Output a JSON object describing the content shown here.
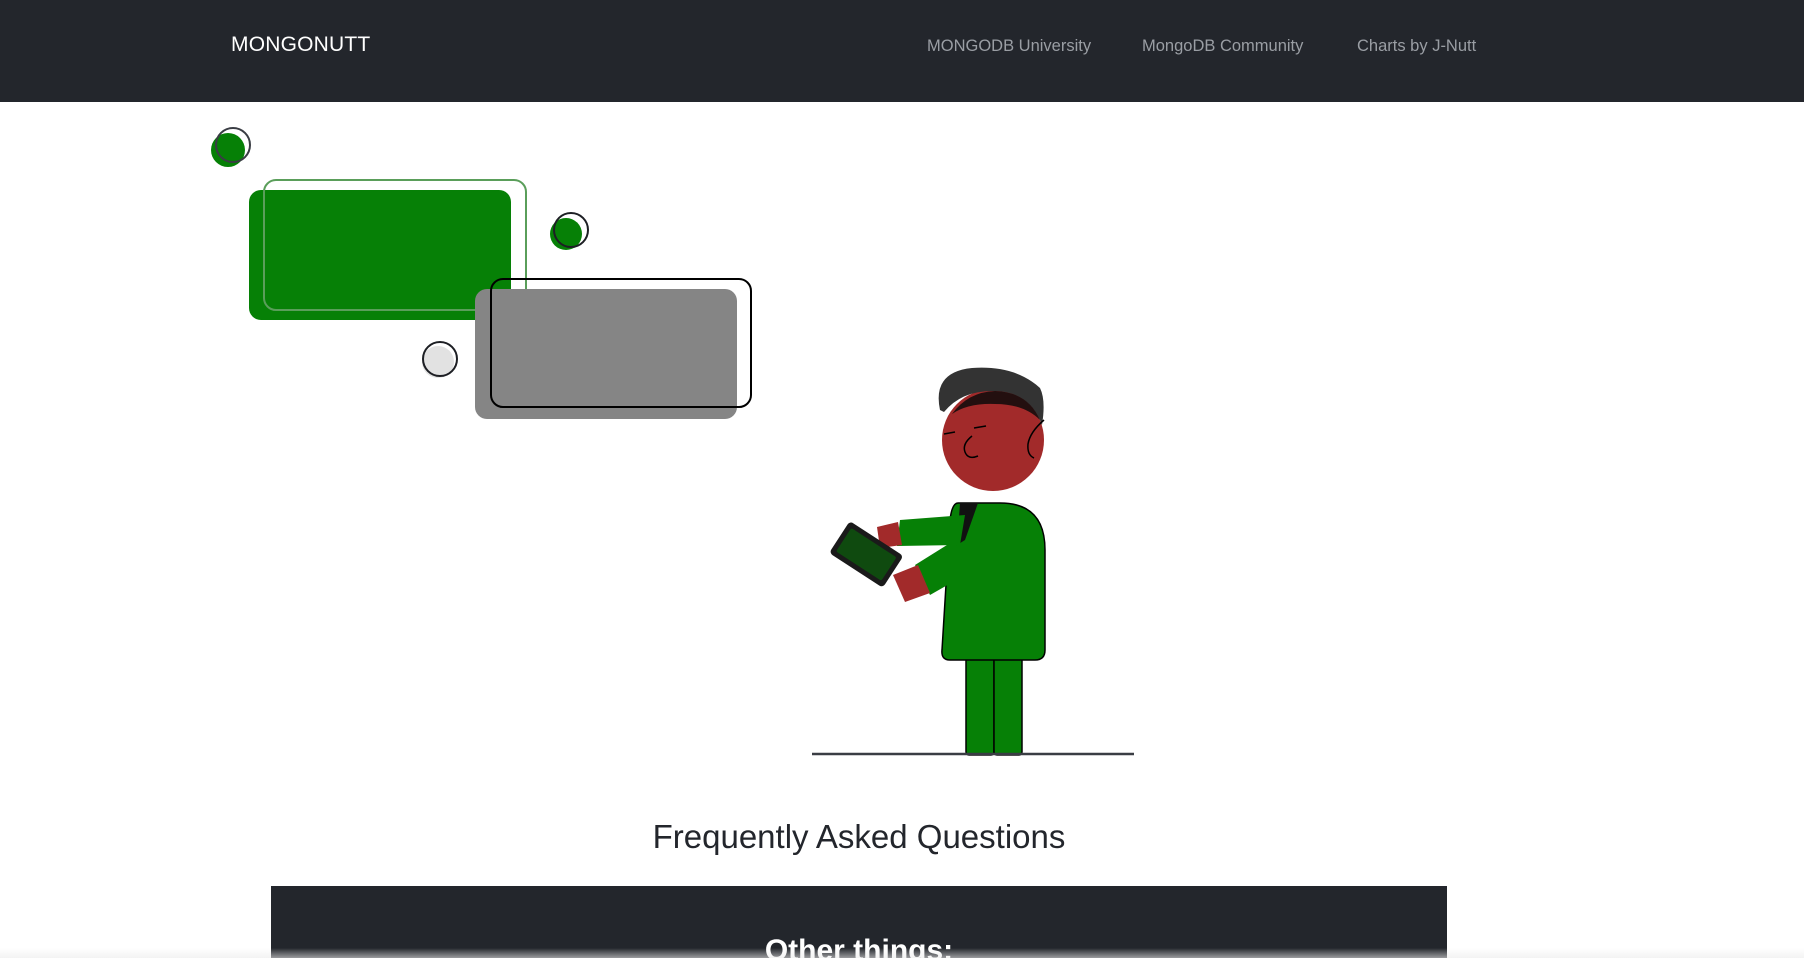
{
  "navbar": {
    "brand": "MONGONUTT",
    "links": [
      {
        "label": "MONGODB University"
      },
      {
        "label": "MongoDB Community"
      },
      {
        "label": "Charts by J-Nutt"
      }
    ]
  },
  "faq": {
    "title": "Frequently Asked Questions"
  },
  "other_section": {
    "title": "Other things:"
  },
  "colors": {
    "navbar_bg": "#23262c",
    "accent_green": "#068006",
    "gray_card": "#858585",
    "face_red": "#a22a2a",
    "hair": "#333333"
  },
  "icons": {
    "illustration": "person-with-tablet-illustration"
  }
}
